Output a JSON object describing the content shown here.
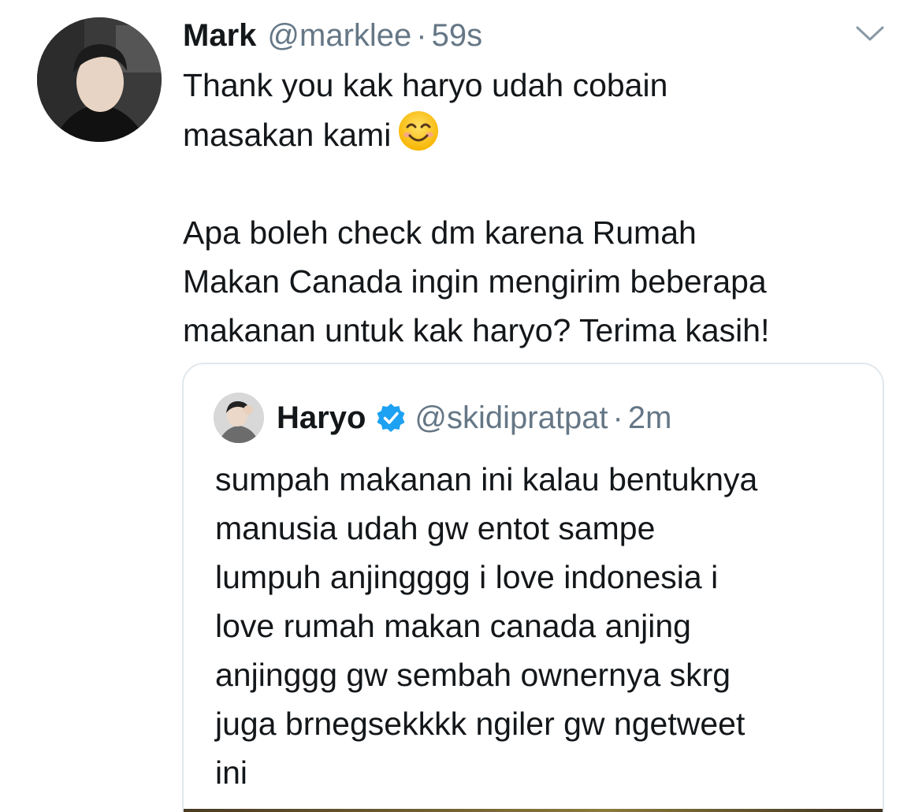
{
  "tweet": {
    "author_name": "Mark",
    "handle": "@marklee",
    "separator": "·",
    "time": "59s",
    "lines": [
      "Thank you kak haryo udah cobain",
      "masakan kami",
      "",
      "Apa boleh check dm karena Rumah",
      "Makan Canada ingin mengirim beberapa",
      "makanan untuk kak haryo? Terima kasih!"
    ],
    "emoji": "smiling-face-with-smiling-eyes"
  },
  "quoted_tweet": {
    "author_name": "Haryo",
    "verified": true,
    "handle": "@skidipratpat",
    "separator": "·",
    "time": "2m",
    "lines": [
      "sumpah makanan ini kalau bentuknya",
      "manusia udah gw entot sampe",
      "lumpuh anjingggg i love indonesia i",
      "love rumah makan canada anjing",
      "anjinggg gw sembah ownernya skrg",
      "juga brnegsekkkk ngiler gw ngetweet",
      "ini"
    ]
  },
  "colors": {
    "text": "#14171a",
    "secondary": "#657786",
    "verified": "#1da1f2",
    "border": "#e1e8ed"
  }
}
